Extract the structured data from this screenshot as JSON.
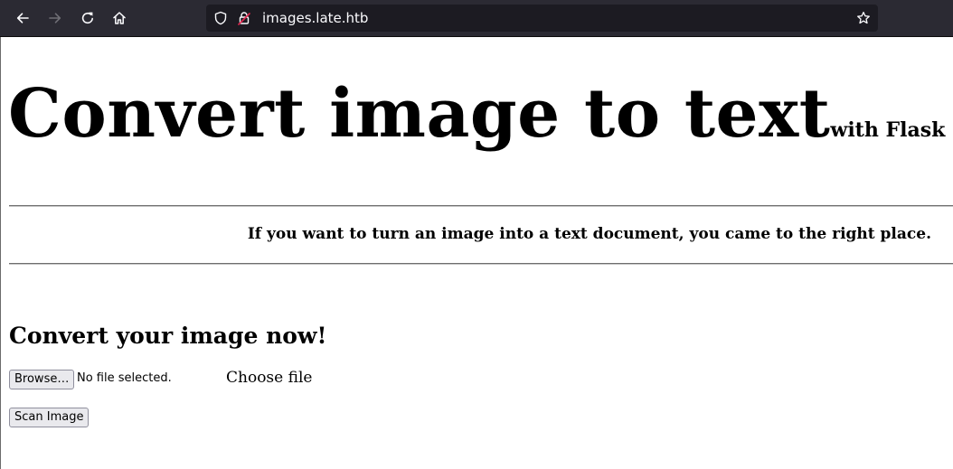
{
  "browser": {
    "url": "images.late.htb",
    "icons": {
      "back": "arrow-left-icon",
      "forward": "arrow-right-icon",
      "reload": "reload-icon",
      "home": "home-icon",
      "tracking_protection": "shield-icon",
      "connection": "lock-icon",
      "bookmark": "star-icon"
    },
    "colors": {
      "toolbar": "#2b2a33",
      "urlbar": "#1c1b22",
      "insecure_lock_accent": "#e22850"
    }
  },
  "page": {
    "headline": "Convert image to text",
    "headline_suffix": "with Flask",
    "tagline": "If you want to turn an image into a text document, you came to the right place.",
    "section_title": "Convert your image now!",
    "form": {
      "browse_label": "Browse…",
      "file_status": "No file selected.",
      "choose_label": "Choose file",
      "submit_label": "Scan Image"
    }
  }
}
